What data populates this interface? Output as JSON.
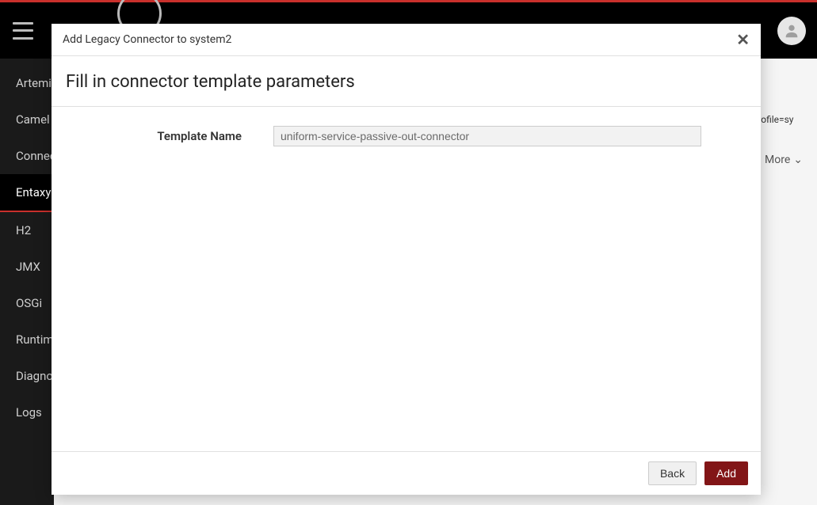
{
  "sidebar": {
    "items": [
      {
        "label": "Artemis"
      },
      {
        "label": "Camel"
      },
      {
        "label": "Connect"
      },
      {
        "label": "Entaxy"
      },
      {
        "label": "H2"
      },
      {
        "label": "JMX"
      },
      {
        "label": "OSGi"
      },
      {
        "label": "Runtime"
      },
      {
        "label": "Diagnostics"
      },
      {
        "label": "Logs"
      }
    ],
    "activeIndex": 3
  },
  "background": {
    "path_fragment": "s,profile=sy",
    "more_label": "More"
  },
  "modal": {
    "title": "Add Legacy Connector to system2",
    "close_glyph": "✕",
    "subtitle": "Fill in connector template parameters",
    "form": {
      "template_name_label": "Template Name",
      "template_name_value": "uniform-service-passive-out-connector"
    },
    "footer": {
      "back_label": "Back",
      "add_label": "Add"
    }
  }
}
